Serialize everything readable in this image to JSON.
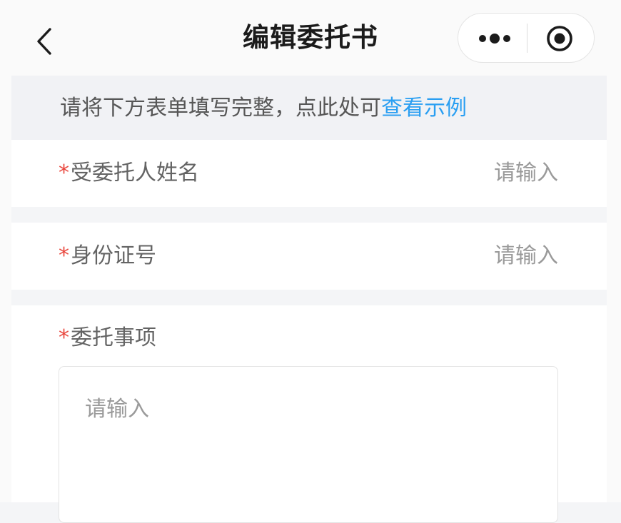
{
  "nav": {
    "title": "编辑委托书",
    "back_icon": "chevron-left-icon",
    "more_icon": "more-dots-icon",
    "close_icon": "target-circle-icon"
  },
  "tip": {
    "text": "请将下方表单填写完整，点此处可",
    "link": "查看示例",
    "link_color": "#2a9ff2"
  },
  "form": {
    "required_mark": "*",
    "required_color": "#e9483f",
    "fields": [
      {
        "label": "受委托人姓名",
        "placeholder": "请输入"
      },
      {
        "label": "身份证号",
        "placeholder": "请输入"
      }
    ],
    "matters": {
      "label": "委托事项",
      "placeholder": "请输入"
    }
  }
}
